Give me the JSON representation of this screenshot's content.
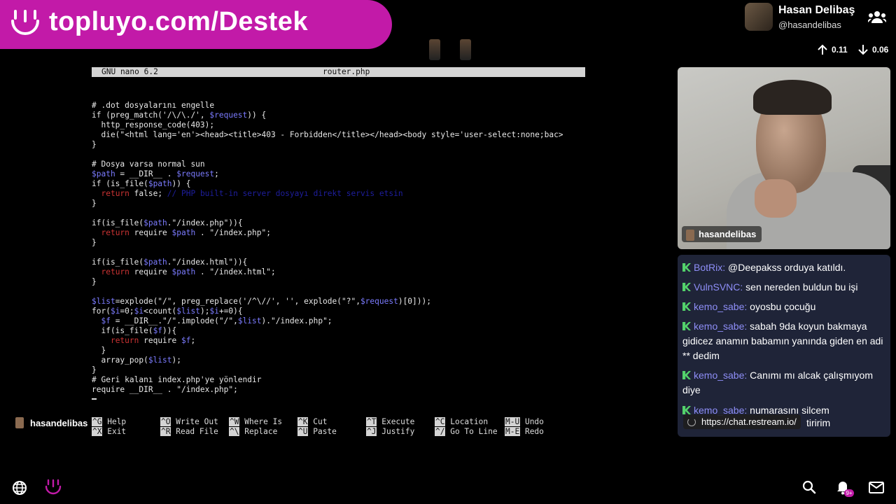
{
  "banner": {
    "text": "topluyo.com/Destek"
  },
  "profile": {
    "name": "Hasan Delibaş",
    "handle": "@hasandelibas",
    "up": "0.11",
    "down": "0.06"
  },
  "nano": {
    "version": "GNU nano 6.2",
    "file": "router.php",
    "lines": [
      {
        "t": 11,
        "segs": [
          [
            "# .dot dosyalarını engelle",
            ""
          ]
        ]
      },
      {
        "t": 12,
        "segs": [
          [
            "if (preg_match('/\\/\\./', ",
            ""
          ],
          [
            "$request",
            "var"
          ],
          [
            ")) {",
            ""
          ]
        ]
      },
      {
        "t": 13,
        "segs": [
          [
            "  http_response_code(403);",
            ""
          ]
        ]
      },
      {
        "t": 14,
        "segs": [
          [
            "  die(\"<html lang='en'><head><title>403 - Forbidden</title></head><body style='user-select:none;bac>",
            ""
          ]
        ]
      },
      {
        "t": 15,
        "segs": [
          [
            "}",
            ""
          ]
        ]
      },
      {
        "t": 17,
        "segs": [
          [
            "# Dosya varsa normal sun",
            ""
          ]
        ]
      },
      {
        "t": 18,
        "segs": [
          [
            "$path",
            "var"
          ],
          [
            " = __DIR__ . ",
            ""
          ],
          [
            "$request",
            "var"
          ],
          [
            ";",
            ""
          ]
        ]
      },
      {
        "t": 19,
        "segs": [
          [
            "if (is_file(",
            ""
          ],
          [
            "$path",
            "var"
          ],
          [
            ")) {",
            ""
          ]
        ]
      },
      {
        "t": 20,
        "segs": [
          [
            "  ",
            ""
          ],
          [
            "return",
            "kw"
          ],
          [
            " false; ",
            ""
          ],
          [
            "// PHP built-in server dosyayı direkt servis etsin",
            "cm"
          ]
        ]
      },
      {
        "t": 21,
        "segs": [
          [
            "}",
            ""
          ]
        ]
      },
      {
        "t": 23,
        "segs": [
          [
            "if(is_file(",
            ""
          ],
          [
            "$path",
            "var"
          ],
          [
            ".\"/index.php\")){",
            ""
          ]
        ]
      },
      {
        "t": 24,
        "segs": [
          [
            "  ",
            ""
          ],
          [
            "return",
            "kw"
          ],
          [
            " require ",
            ""
          ],
          [
            "$path",
            "var"
          ],
          [
            " . \"/index.php\";",
            ""
          ]
        ]
      },
      {
        "t": 25,
        "segs": [
          [
            "}",
            ""
          ]
        ]
      },
      {
        "t": 27,
        "segs": [
          [
            "if(is_file(",
            ""
          ],
          [
            "$path",
            "var"
          ],
          [
            ".\"/index.html\")){",
            ""
          ]
        ]
      },
      {
        "t": 28,
        "segs": [
          [
            "  ",
            ""
          ],
          [
            "return",
            "kw"
          ],
          [
            " require ",
            ""
          ],
          [
            "$path",
            "var"
          ],
          [
            " . \"/index.html\";",
            ""
          ]
        ]
      },
      {
        "t": 29,
        "segs": [
          [
            "}",
            ""
          ]
        ]
      },
      {
        "t": 31,
        "segs": [
          [
            "$list",
            "var"
          ],
          [
            "=explode(\"/\", preg_replace('/^\\//', '', explode(\"?\",",
            ""
          ],
          [
            "$request",
            "var"
          ],
          [
            ")[0]));",
            ""
          ]
        ]
      },
      {
        "t": 32,
        "segs": [
          [
            "for(",
            ""
          ],
          [
            "$i",
            "var"
          ],
          [
            "=0;",
            ""
          ],
          [
            "$i",
            "var"
          ],
          [
            "<count(",
            ""
          ],
          [
            "$list",
            "var"
          ],
          [
            ");",
            ""
          ],
          [
            "$i",
            "var"
          ],
          [
            "+=0){",
            ""
          ]
        ]
      },
      {
        "t": 33,
        "segs": [
          [
            "  ",
            ""
          ],
          [
            "$f",
            "var"
          ],
          [
            " = __DIR__.\"/\".implode(\"/\",",
            ""
          ],
          [
            "$list",
            "var"
          ],
          [
            ").\"/index.php\";",
            ""
          ]
        ]
      },
      {
        "t": 34,
        "segs": [
          [
            "  if(is_file(",
            ""
          ],
          [
            "$f",
            "var"
          ],
          [
            ")){",
            ""
          ]
        ]
      },
      {
        "t": 35,
        "segs": [
          [
            "    ",
            ""
          ],
          [
            "return",
            "kw"
          ],
          [
            " require ",
            ""
          ],
          [
            "$f",
            "var"
          ],
          [
            ";",
            ""
          ]
        ]
      },
      {
        "t": 36,
        "segs": [
          [
            "  }",
            ""
          ]
        ]
      },
      {
        "t": 37,
        "segs": [
          [
            "  array_pop(",
            ""
          ],
          [
            "$list",
            "var"
          ],
          [
            ");",
            ""
          ]
        ]
      },
      {
        "t": 38,
        "segs": [
          [
            "}",
            ""
          ]
        ]
      },
      {
        "t": 39,
        "segs": [
          [
            "# Geri kalanı index.php'ye yönlendir",
            ""
          ]
        ]
      },
      {
        "t": 40,
        "segs": [
          [
            "require __DIR__ . \"/index.php\";",
            ""
          ]
        ]
      }
    ],
    "shortcuts": [
      {
        "k1": "^G",
        "l1": "Help",
        "k2": "^X",
        "l2": "Exit"
      },
      {
        "k1": "^O",
        "l1": "Write Out",
        "k2": "^R",
        "l2": "Read File"
      },
      {
        "k1": "^W",
        "l1": "Where Is",
        "k2": "^\\",
        "l2": "Replace"
      },
      {
        "k1": "^K",
        "l1": "Cut",
        "k2": "^U",
        "l2": "Paste"
      },
      {
        "k1": "^T",
        "l1": "Execute",
        "k2": "^J",
        "l2": "Justify"
      },
      {
        "k1": "^C",
        "l1": "Location",
        "k2": "^/",
        "l2": "Go To Line"
      },
      {
        "k1": "M-U",
        "l1": "Undo",
        "k2": "M-E",
        "l2": "Redo"
      }
    ]
  },
  "cam": {
    "label": "hasandelibas"
  },
  "host": {
    "name": "hasandelibas"
  },
  "chat": {
    "messages": [
      {
        "user": "BotRix:",
        "text": " @Deepakss orduya katıldı."
      },
      {
        "user": "VulnSVNC:",
        "text": " sen nereden buldun bu işi"
      },
      {
        "user": "kemo_sabe:",
        "text": " oyosbu çocuğu"
      },
      {
        "user": "kemo_sabe:",
        "text": " sabah 9da koyun bakmaya gidicez anamın babamın yanında giden en adi ** dedim"
      },
      {
        "user": "kemo_sabe:",
        "text": " Canımı mı alcak çalışmıyom diye"
      },
      {
        "user": "kemo_sabe:",
        "text": " numarasını silcem"
      }
    ],
    "url": "https://chat.restream.io/",
    "tail": "tiririm"
  },
  "bottom": {
    "notif_badge": "9+"
  },
  "colors": {
    "brand": "#c21aa8",
    "chat_bg": "#1f2438",
    "username": "#8e8ef7",
    "badge": "#53d26b"
  }
}
